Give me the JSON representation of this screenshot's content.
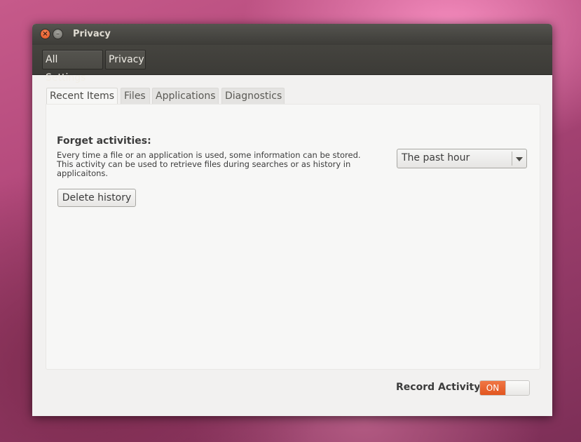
{
  "window": {
    "title": "Privacy"
  },
  "breadcrumb": {
    "items": [
      "All Settings",
      "Privacy"
    ]
  },
  "tabs": [
    {
      "label": "Recent Items",
      "active": true
    },
    {
      "label": "Files",
      "active": false
    },
    {
      "label": "Applications",
      "active": false
    },
    {
      "label": "Diagnostics",
      "active": false
    }
  ],
  "forget": {
    "title": "Forget activities:",
    "description": "Every time a file or an application is used, some information can be stored. This activity can be used to retrieve files during searches or as history in applicaitons.",
    "selected_period": "The past hour",
    "delete_label": "Delete history"
  },
  "record": {
    "label": "Record Activity",
    "switch_on_label": "ON",
    "enabled": true
  },
  "colors": {
    "accent": "#e2561f",
    "titlebar": "#3d3c38"
  }
}
